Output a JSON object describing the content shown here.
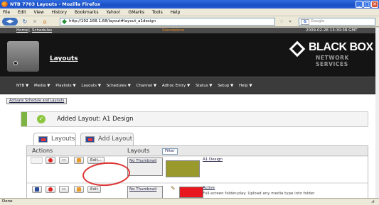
{
  "window": {
    "title": "NTB 7703 Layouts - Mozilla Firefox",
    "buttons": [
      "_",
      "□",
      "✕"
    ]
  },
  "menubar": [
    "File",
    "Edit",
    "View",
    "History",
    "Bookmarks",
    "Yahoo!",
    "GMarks",
    "Tools",
    "Help"
  ],
  "toolbar": {
    "url": "http://192.168.1.68/layout#layout_a1design",
    "search_placeholder": "Google",
    "search_engine": "G"
  },
  "page": {
    "top_links": {
      "home": "Home",
      "sep": "|",
      "schedules": "Schedules"
    },
    "mode": "Standalone",
    "datetime": "2009-02-28 13:30:38 GMT",
    "header_title": "Layouts",
    "brand": "BLACK BOX",
    "brand_sub": "NETWORK SERVICES",
    "nav": [
      "NTB ▼",
      "Media ▼",
      "Playlists ▼",
      "Layouts ▼",
      "Schedules ▼",
      "Channel ▼",
      "Adhoc Entry ▼",
      "Status ▼",
      "Setup ▼",
      "Help ▼"
    ],
    "activate_button": "Activate Schedule and Layouts",
    "banner": "Added Layout: A1 Design",
    "tabs": [
      "Layouts",
      "Add Layout"
    ],
    "actions_header": "Actions",
    "layouts_header": "Layouts",
    "filter_button": "Filter",
    "rows": [
      {
        "edit": "Edit...",
        "thumb": "No Thumbnail",
        "color": "#9a9a2c",
        "name": "A1 Design",
        "desc": ""
      },
      {
        "edit": "Edit",
        "thumb": "No Thumbnail",
        "color": "#e8171f",
        "name": "Active",
        "desc": "Full-screen folder-play. Upload any media type into folder"
      }
    ]
  },
  "status": "Done"
}
